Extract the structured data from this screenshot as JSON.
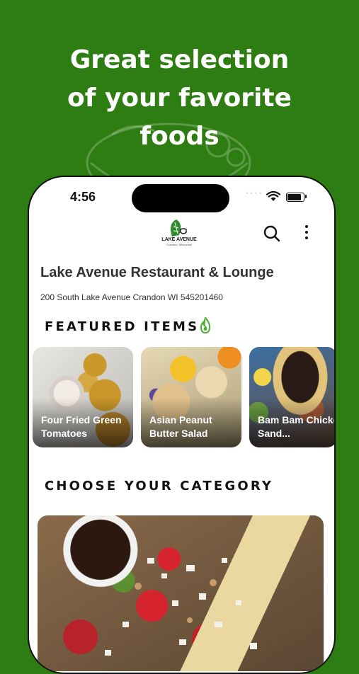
{
  "headline": {
    "line1": "Great selection",
    "line2": "of your favorite",
    "line3": "foods"
  },
  "status_bar": {
    "time": "4:56",
    "signal_dots": "····"
  },
  "header": {
    "logo_name": "LAKE AVENUE",
    "logo_sub": "Crandon, Wisconsin",
    "icons": [
      "search-icon",
      "more-vertical-icon"
    ]
  },
  "restaurant": {
    "name": "Lake Avenue Restaurant & Lounge",
    "address": "200 South Lake Avenue Crandon WI 545201460"
  },
  "featured": {
    "title": "FEATURED ITEMS",
    "icon": "flame-icon",
    "items": [
      {
        "label": "Four Fried Green Tomatoes"
      },
      {
        "label": "Asian Peanut Butter Salad"
      },
      {
        "label": "Bam Bam Chicken Sand..."
      }
    ]
  },
  "category": {
    "title": "CHOOSE YOUR CATEGORY"
  },
  "colors": {
    "background": "#2e7d12",
    "accent_green": "#4caf2e"
  }
}
